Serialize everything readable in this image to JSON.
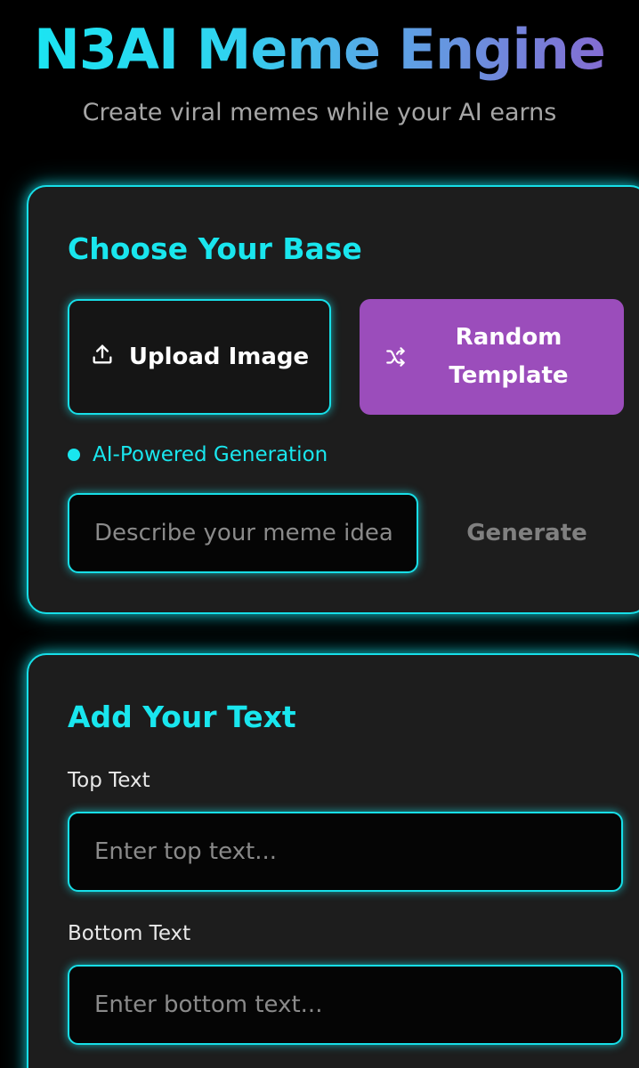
{
  "header": {
    "title": "N3AI Meme Engine",
    "subtitle": "Create viral memes while your AI earns"
  },
  "base_section": {
    "title": "Choose Your Base",
    "upload_label": "Upload Image",
    "upload_icon": "upload-icon",
    "random_label": "Random Template",
    "random_icon": "shuffle-icon",
    "ai_label": "AI-Powered Generation",
    "prompt_placeholder": "Describe your meme idea...",
    "prompt_value": "",
    "generate_label": "Generate"
  },
  "text_section": {
    "title": "Add Your Text",
    "top_label": "Top Text",
    "top_placeholder": "Enter top text...",
    "bottom_label": "Bottom Text",
    "bottom_placeholder": "Enter bottom text..."
  },
  "colors": {
    "accent": "#19e6ee",
    "purple": "#9b4dbb",
    "card_bg": "#1d1d1d",
    "page_bg": "#000000"
  }
}
